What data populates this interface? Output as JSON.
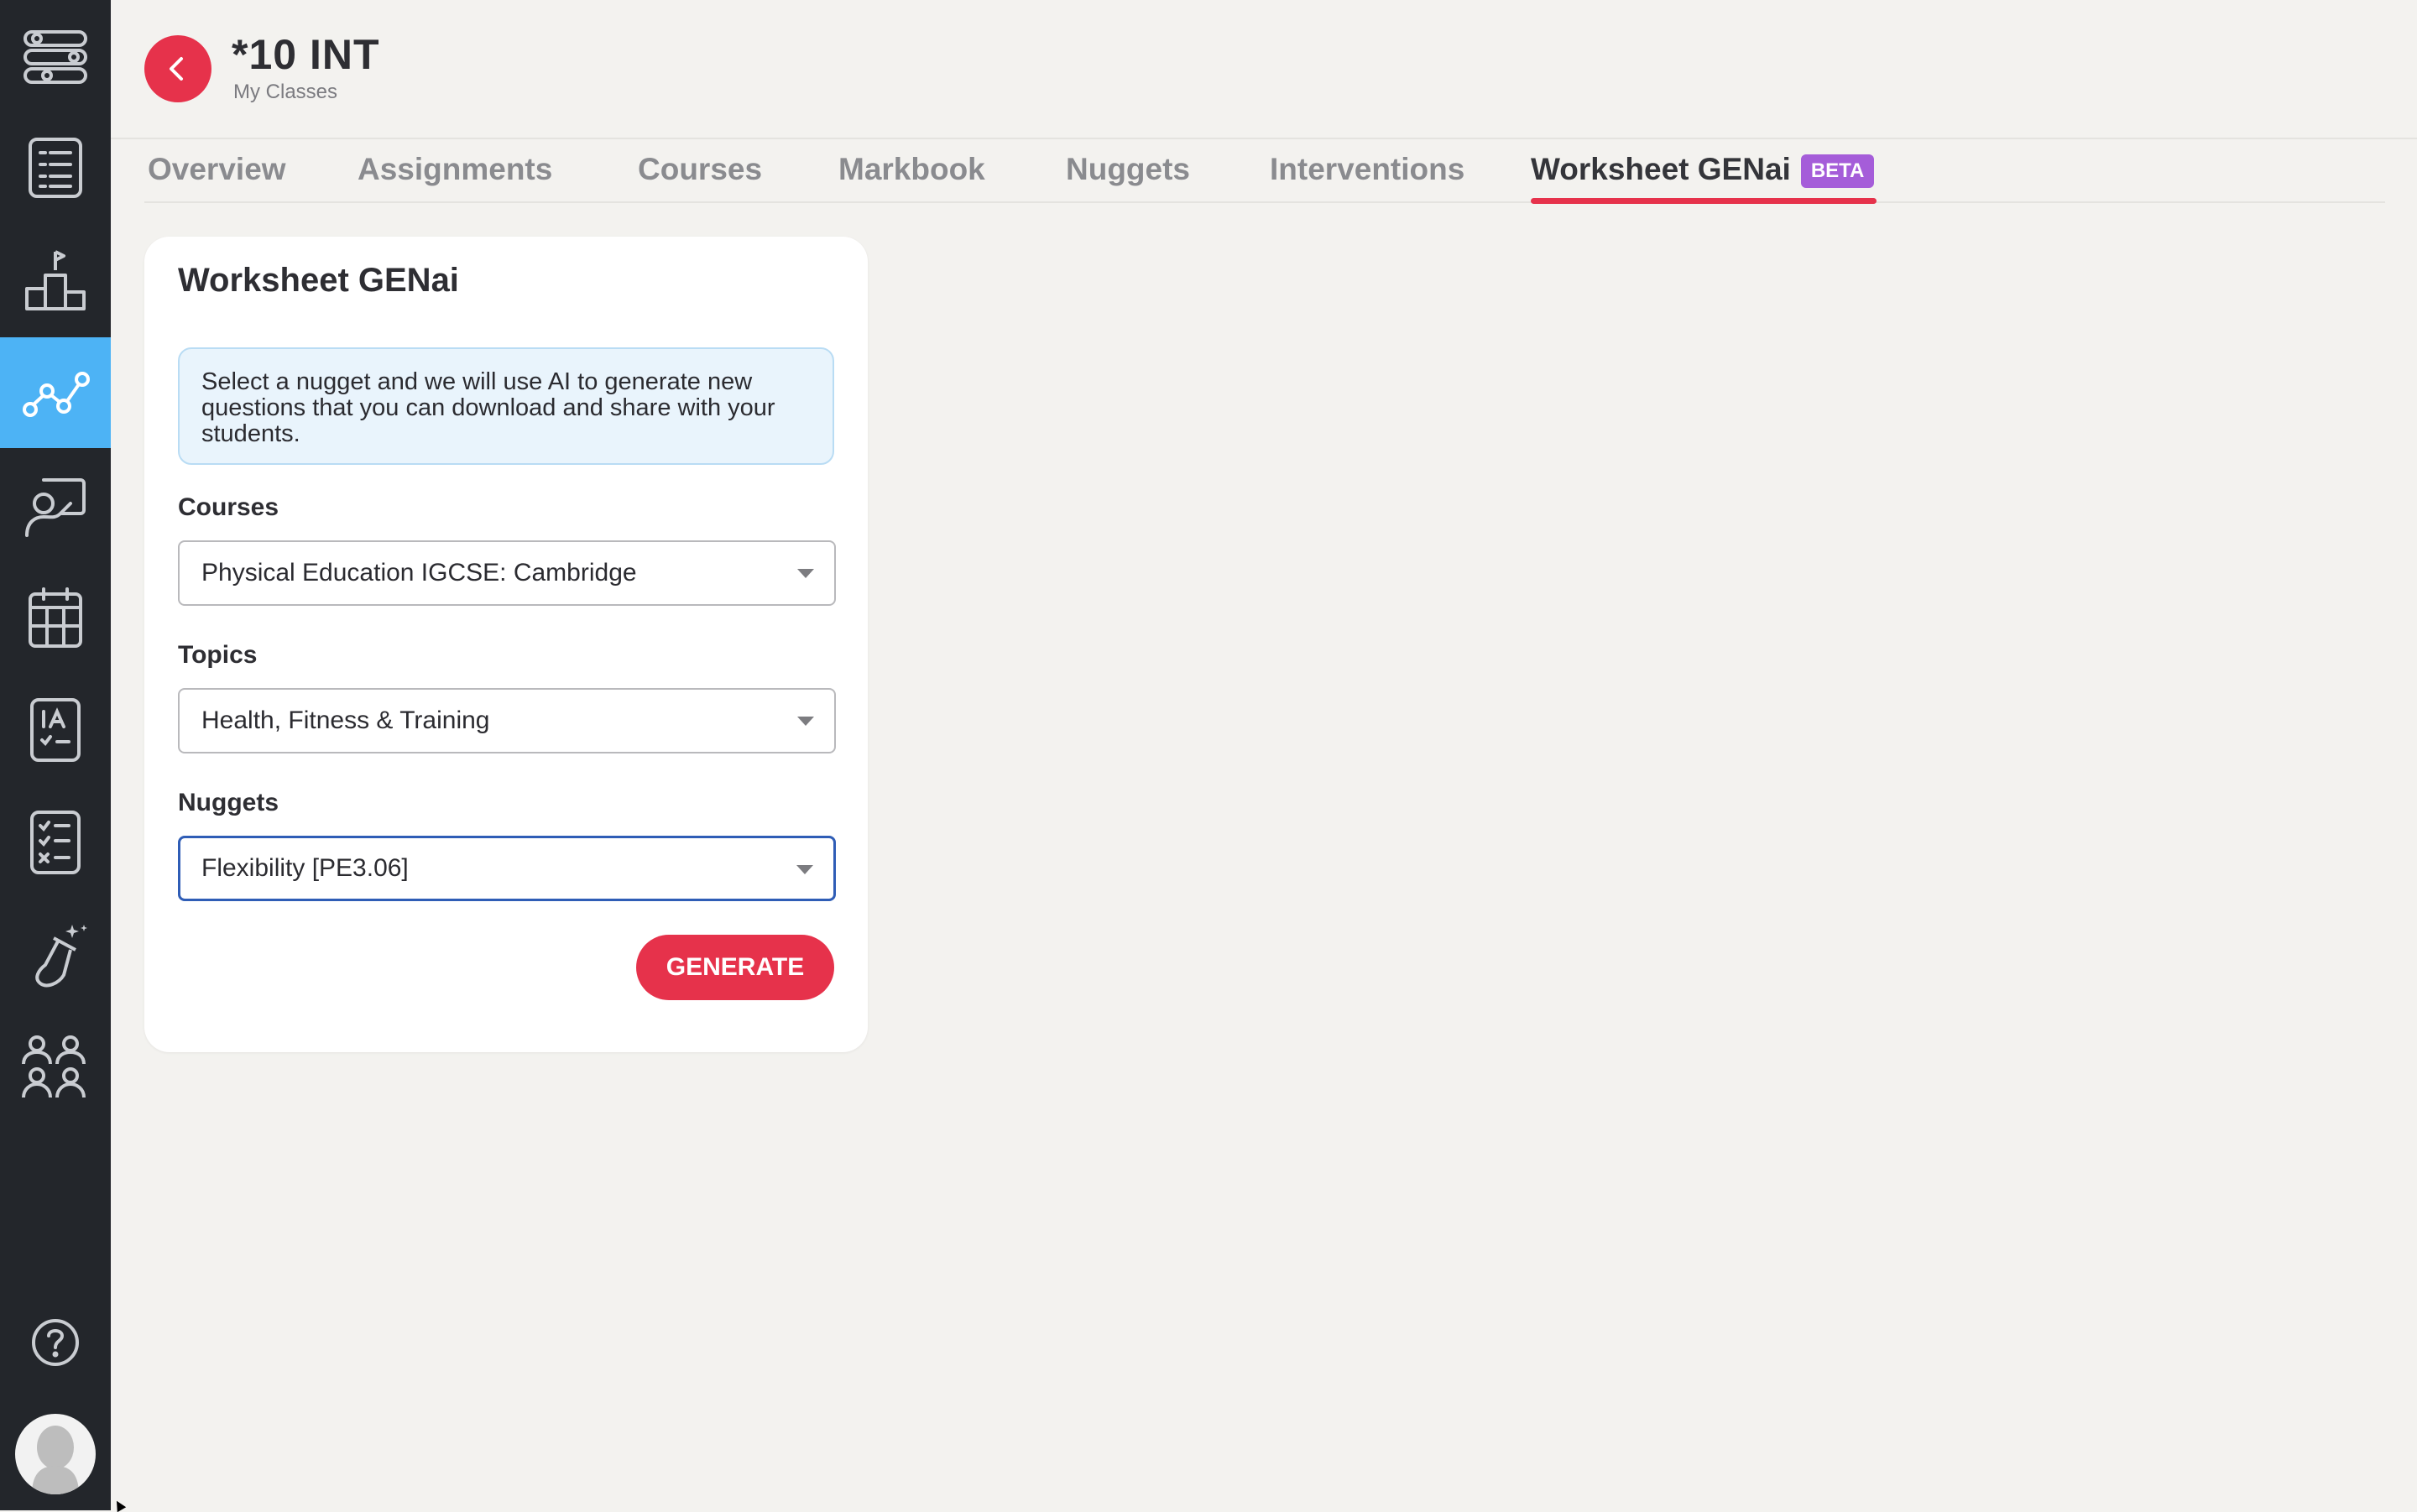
{
  "sidebar": {
    "items": [
      {
        "icon": "workflow-icon"
      },
      {
        "icon": "list-icon"
      },
      {
        "icon": "podium-icon"
      },
      {
        "icon": "analytics-icon",
        "active": true
      },
      {
        "icon": "teacher-icon"
      },
      {
        "icon": "calendar-icon"
      },
      {
        "icon": "ia-icon"
      },
      {
        "icon": "checklist-icon"
      },
      {
        "icon": "science-flask-icon"
      },
      {
        "icon": "group-icon"
      }
    ],
    "help_icon": "help-icon",
    "avatar_icon": "user-avatar"
  },
  "header": {
    "title": "*10 INT",
    "breadcrumb": "My Classes"
  },
  "tabs": [
    {
      "label": "Overview"
    },
    {
      "label": "Assignments"
    },
    {
      "label": "Courses"
    },
    {
      "label": "Markbook"
    },
    {
      "label": "Nuggets"
    },
    {
      "label": "Interventions"
    },
    {
      "label": "Worksheet GENai",
      "badge": "BETA",
      "active": true
    }
  ],
  "card": {
    "title": "Worksheet GENai",
    "info": "Select a nugget and we will use AI to generate new questions that you can download and share with your students.",
    "courses_label": "Courses",
    "courses_value": "Physical Education IGCSE: Cambridge",
    "topics_label": "Topics",
    "topics_value": "Health, Fitness & Training",
    "nuggets_label": "Nuggets",
    "nuggets_value": "Flexibility [PE3.06]",
    "generate_label": "GENERATE"
  },
  "colors": {
    "accent": "#e6324b",
    "sidebar_bg": "#23262b",
    "sidebar_active": "#4db3f5",
    "beta_badge": "#a55dd9",
    "focus_border": "#2f5db6"
  }
}
